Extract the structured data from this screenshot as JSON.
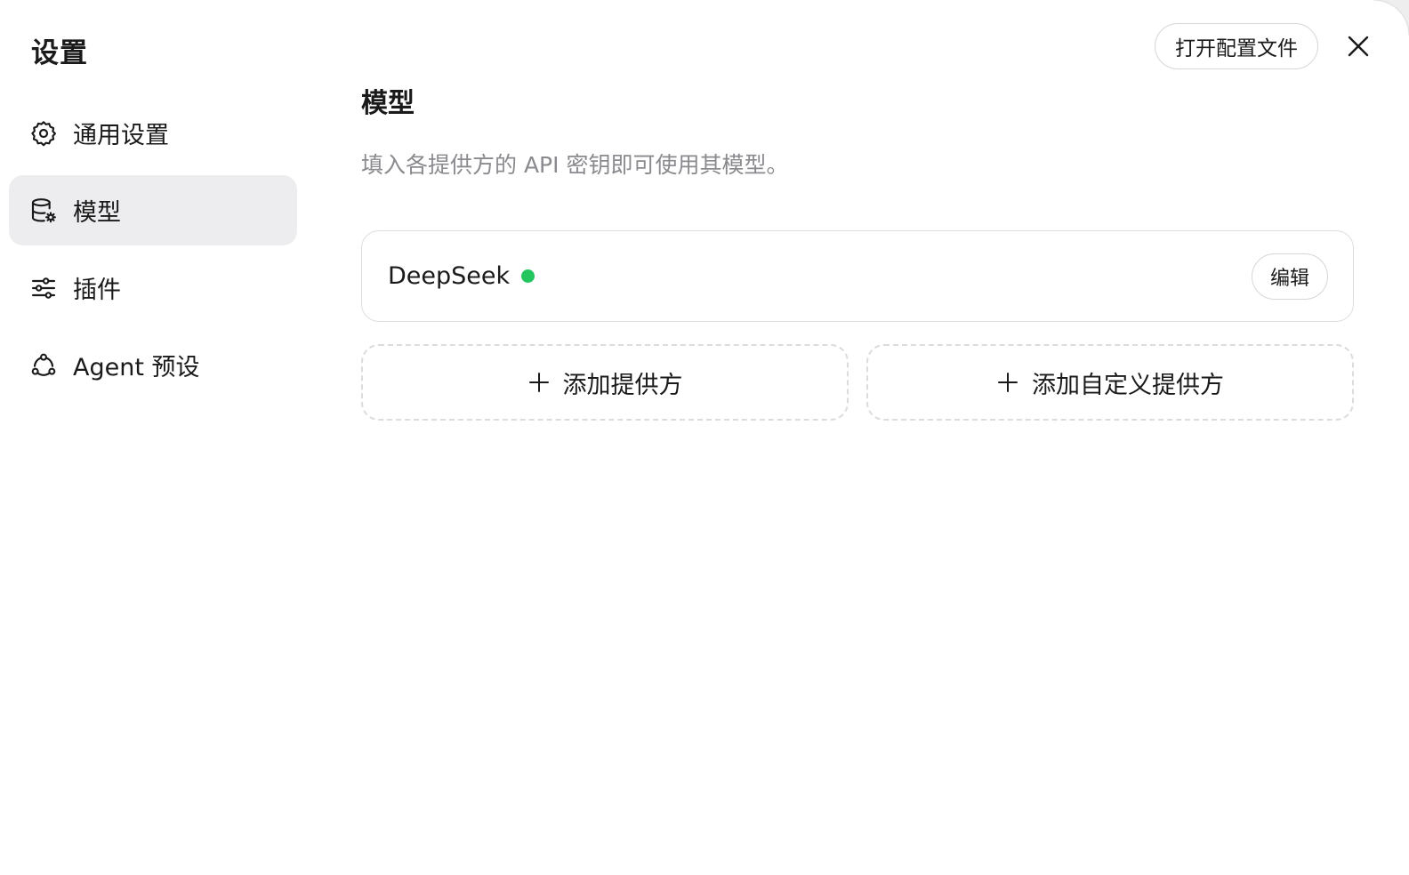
{
  "window": {
    "title": "设置"
  },
  "sidebar": {
    "items": [
      {
        "label": "通用设置",
        "icon": "gear-icon",
        "active": false
      },
      {
        "label": "模型",
        "icon": "database-gear-icon",
        "active": true
      },
      {
        "label": "插件",
        "icon": "sliders-icon",
        "active": false
      },
      {
        "label": "Agent 预设",
        "icon": "agent-network-icon",
        "active": false
      }
    ]
  },
  "header": {
    "open_config_label": "打开配置文件",
    "close_icon": "close-icon"
  },
  "main": {
    "title": "模型",
    "description": "填入各提供方的 API 密钥即可使用其模型。",
    "providers": [
      {
        "name": "DeepSeek",
        "status_color": "#22c55e",
        "edit_label": "编辑"
      }
    ],
    "add_provider_label": "添加提供方",
    "add_custom_provider_label": "添加自定义提供方"
  },
  "colors": {
    "active_bg": "#ededf0",
    "status_ok": "#22c55e",
    "muted_text": "#8a8a8f"
  }
}
